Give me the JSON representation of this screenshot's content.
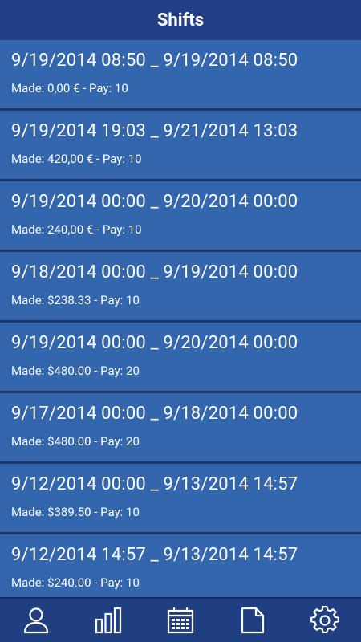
{
  "header": {
    "title": "Shifts"
  },
  "shifts": [
    {
      "range": "9/19/2014 08:50 _ 9/19/2014 08:50",
      "summary": "Made: 0,00 € - Pay: 10"
    },
    {
      "range": "9/19/2014 19:03 _ 9/21/2014 13:03",
      "summary": "Made: 420,00 € - Pay: 10"
    },
    {
      "range": "9/19/2014 00:00 _ 9/20/2014 00:00",
      "summary": "Made: 240,00 € - Pay: 10"
    },
    {
      "range": "9/18/2014 00:00 _ 9/19/2014 00:00",
      "summary": "Made: $238.33 - Pay: 10"
    },
    {
      "range": "9/19/2014 00:00 _ 9/20/2014 00:00",
      "summary": "Made: $480.00 - Pay: 20"
    },
    {
      "range": "9/17/2014 00:00 _ 9/18/2014 00:00",
      "summary": "Made: $480.00 - Pay: 20"
    },
    {
      "range": "9/12/2014 00:00 _ 9/13/2014 14:57",
      "summary": "Made: $389.50 - Pay: 10"
    },
    {
      "range": "9/12/2014 14:57 _ 9/13/2014 14:57",
      "summary": "Made: $240.00 - Pay: 10"
    }
  ],
  "nav": {
    "items": [
      {
        "icon": "person-icon"
      },
      {
        "icon": "bar-chart-icon"
      },
      {
        "icon": "calendar-icon"
      },
      {
        "icon": "document-icon"
      },
      {
        "icon": "gear-icon"
      }
    ]
  },
  "colors": {
    "header_bg": "#233f86",
    "item_bg": "#3366ad",
    "nav_bg": "#1f3f82",
    "text": "#ffffff"
  }
}
